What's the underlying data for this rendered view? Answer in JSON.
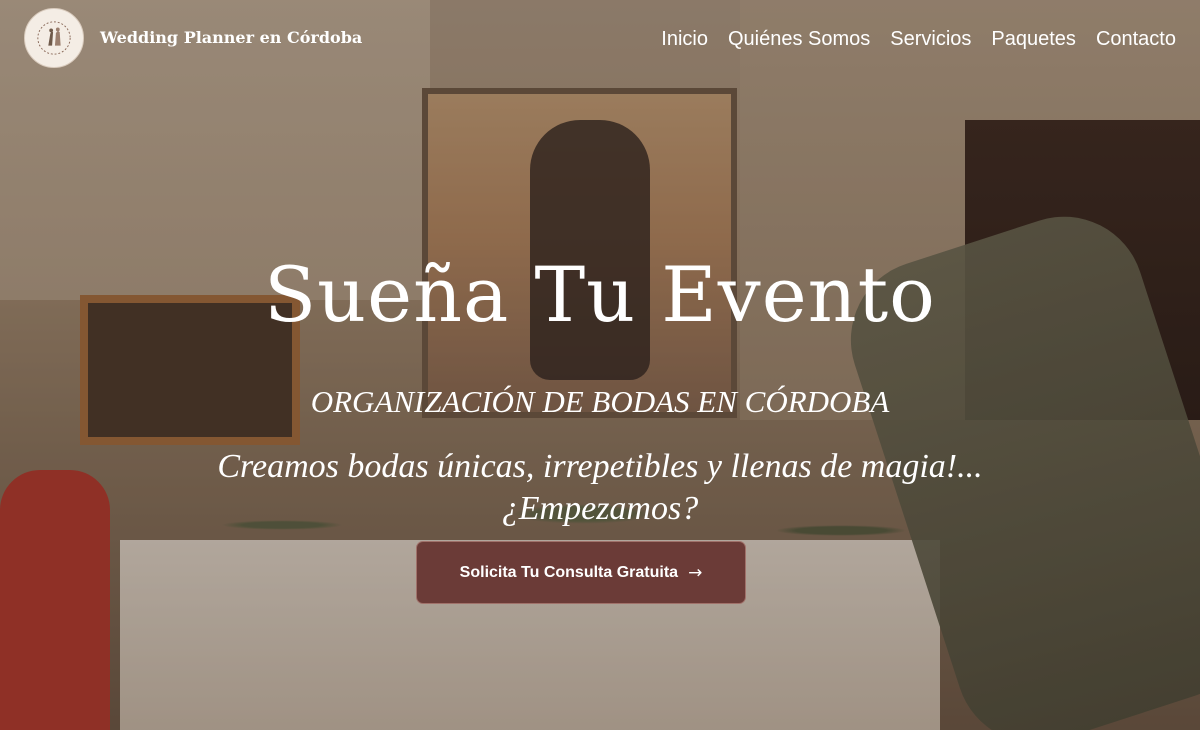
{
  "header": {
    "brand": "Wedding Planner en Córdoba",
    "logo_icon": "wedding-couple-logo-icon",
    "nav": [
      {
        "label": "Inicio"
      },
      {
        "label": "Quiénes Somos"
      },
      {
        "label": "Servicios"
      },
      {
        "label": "Paquetes"
      },
      {
        "label": "Contacto"
      }
    ]
  },
  "hero": {
    "title": "Sueña Tu Evento",
    "subtitle": "ORGANIZACIÓN DE BODAS EN CÓRDOBA",
    "tagline_line1": "Creamos bodas únicas, irrepetibles y llenas de magia!...",
    "tagline_line2": "¿Empezamos?",
    "cta_label": "Solicita Tu Consulta Gratuita",
    "cta_icon": "arrow-right-icon"
  },
  "colors": {
    "cta_background": "#6b3b37",
    "text": "#ffffff"
  }
}
